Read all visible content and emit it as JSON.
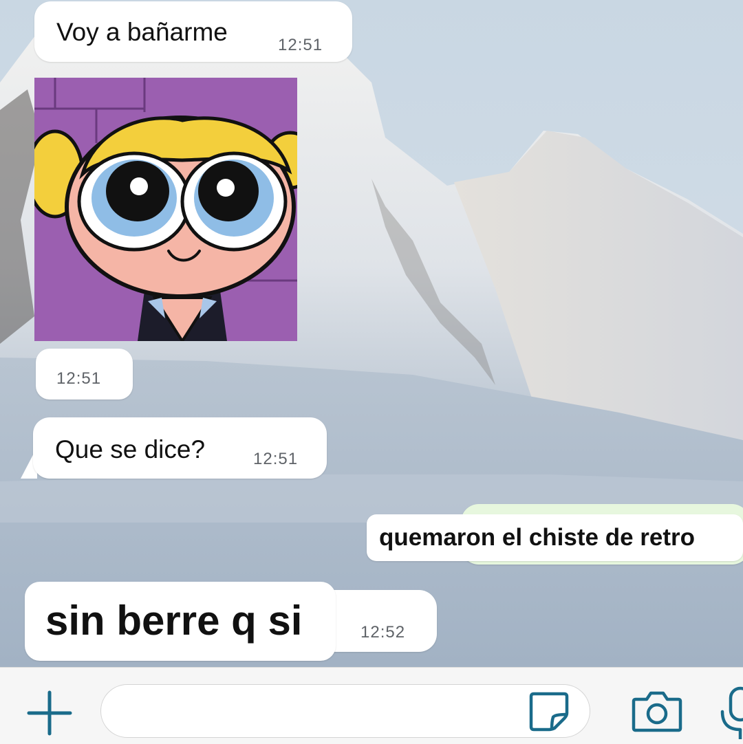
{
  "messages": [
    {
      "text": "Voy a bañarme",
      "time": "12:51"
    },
    {
      "type": "sticker",
      "sticker_icon": "bubbles-powerpuff-sticker",
      "time": "12:51"
    },
    {
      "text": "Que se dice?",
      "time": "12:51"
    },
    {
      "text": "quemaron el chiste de retro",
      "overlay": true
    },
    {
      "text": "sin berre q si",
      "time": "12:52",
      "overlay": true
    }
  ],
  "input_bar": {
    "placeholder": "",
    "icons": [
      "plus-icon",
      "sticker-icon",
      "camera-icon",
      "microphone-icon"
    ],
    "accent_color": "#1a6b8a"
  },
  "colors": {
    "incoming_bubble": "#ffffff",
    "outgoing_bubble": "#e7f7de",
    "sticker_background": "#9b5fb0",
    "sticker_hair": "#f3cf3c",
    "sticker_skin": "#f5b5a6"
  }
}
